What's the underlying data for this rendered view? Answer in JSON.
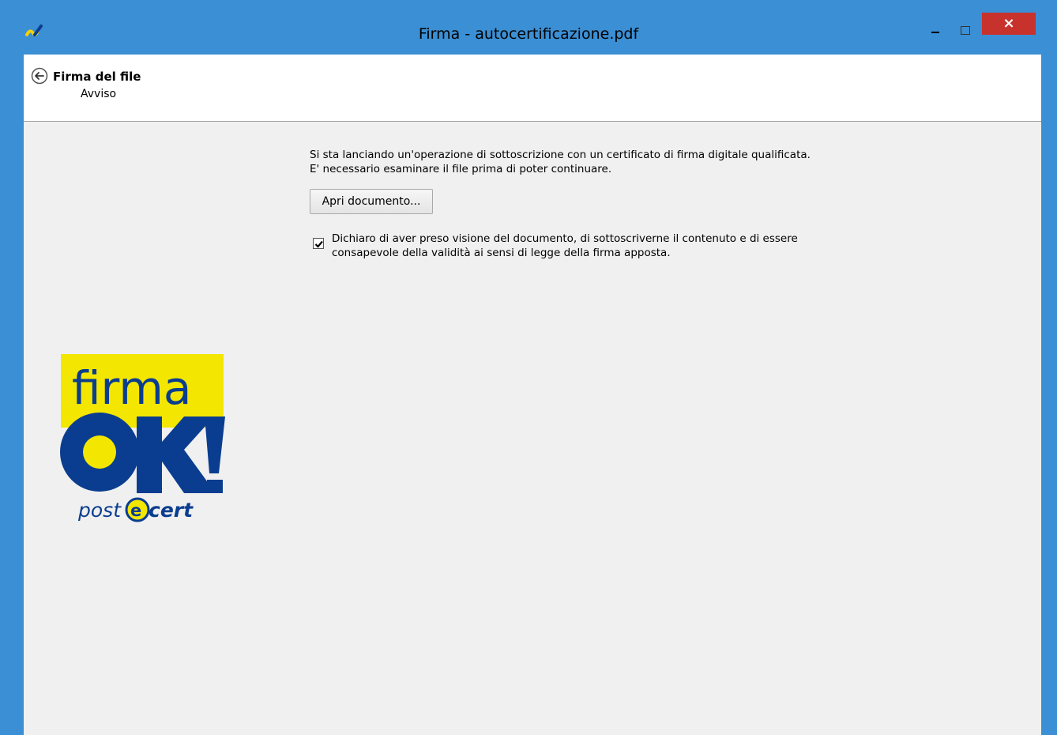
{
  "window": {
    "title": "Firma - autocertificazione.pdf",
    "close_glyph": "×"
  },
  "header": {
    "title": "Firma del file",
    "subtitle": "Avviso"
  },
  "main": {
    "message_line1": "Si sta lanciando un'operazione di sottoscrizione con un certificato di firma digitale qualificata.",
    "message_line2": "E' necessario esaminare il file prima di poter continuare.",
    "open_button_label": "Apri documento...",
    "checkbox_checked": true,
    "checkbox_line1": "Dichiaro di aver preso visione del documento, di sottoscriverne il contenuto e di essere",
    "checkbox_line2": "consapevole della validità ai sensi di legge della firma apposta."
  },
  "logo": {
    "word_top": "firma",
    "word_ok": "OK!",
    "brand": "postecert"
  },
  "colors": {
    "titlebar": "#3b8fd4",
    "close": "#c7322c",
    "logo_yellow": "#f3e600",
    "logo_blue": "#0a3d8f"
  },
  "icons": {
    "app": "signature-pen-icon",
    "back": "back-arrow-icon",
    "minimize": "minimize-icon",
    "maximize": "maximize-icon",
    "close": "close-icon",
    "checkmark": "checkmark-icon"
  }
}
